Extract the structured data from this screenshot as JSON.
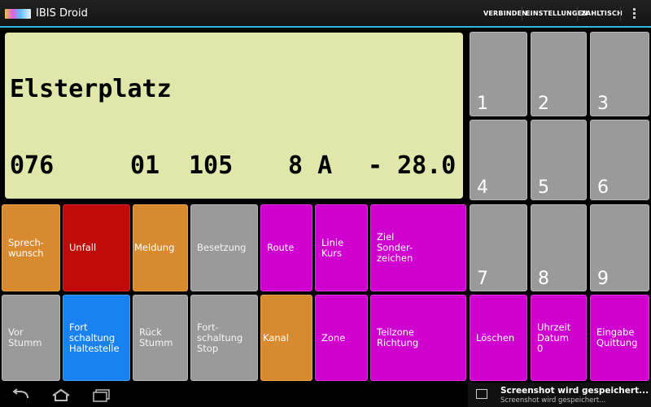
{
  "app": {
    "title": "IBIS Droid"
  },
  "actions": {
    "connect": "VERBINDEN",
    "settings": "EINSTELLUNGEN",
    "counter": "ZAHLTISCH"
  },
  "display": {
    "stop": "Elsterplatz",
    "field1": "076",
    "field2": "01",
    "field3": "105",
    "field4": "8 A",
    "field5": "- 28.0"
  },
  "keys": {
    "sprechwunsch": "Sprech-\nwunsch",
    "unfall": "Unfall",
    "meldung": "Meldung",
    "besetzung": "Besetzung",
    "route": "Route",
    "linie": "Linie\nKurs",
    "ziel": "Ziel\nSonder-\nzeichen",
    "vor": "Vor\nStumm",
    "fort_halt": "Fort\nschaltung\nHaltestelle",
    "rueck": "Rück\nStumm",
    "fort_stop": "Fort-\nschaltung\nStop",
    "kanal": "Kanal",
    "zone": "Zone",
    "teilzone": "Teilzone\nRichtung",
    "loeschen": "Löschen",
    "uhrzeit": "Uhrzeit\nDatum\n0",
    "eingabe": "Eingabe\nQuittung"
  },
  "numpad": [
    "1",
    "2",
    "3",
    "4",
    "5",
    "6",
    "7",
    "8",
    "9"
  ],
  "notification": {
    "title": "Screenshot wird gespeichert...",
    "subtitle": "Screenshot wird gespeichert..."
  },
  "colors": {
    "lcd": "#dfe7aa",
    "grey": "#9a9a9a",
    "orange": "#d88a2e",
    "red": "#c10a0a",
    "blue": "#1a82f0",
    "magenta": "#cf00cf",
    "accent": "#33b5e5"
  },
  "icons": [
    "app-icon",
    "overflow-icon",
    "back-icon",
    "home-icon",
    "recents-icon",
    "image-icon"
  ]
}
